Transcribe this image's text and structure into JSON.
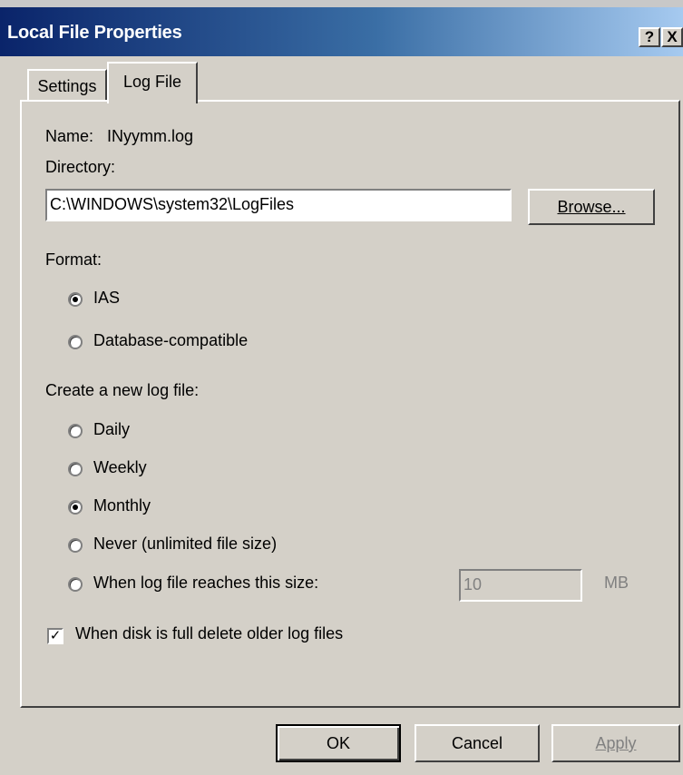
{
  "window": {
    "title": "Local File Properties",
    "help_glyph": "?",
    "close_glyph": "X"
  },
  "tabs": [
    {
      "label": "Settings",
      "selected": false
    },
    {
      "label": "Log File",
      "selected": true
    }
  ],
  "log": {
    "name_label": "Name:",
    "name_value": "INyymm.log",
    "directory_label": "Directory:",
    "directory_value": "C:\\WINDOWS\\system32\\LogFiles",
    "browse_label": "Browse..."
  },
  "format": {
    "label": "Format:",
    "options": [
      {
        "label": "IAS",
        "selected": true
      },
      {
        "label": "Database-compatible",
        "selected": false
      }
    ]
  },
  "new_log": {
    "label": "Create a new log file:",
    "options": [
      {
        "label": "Daily",
        "selected": false
      },
      {
        "label": "Weekly",
        "selected": false
      },
      {
        "label": "Monthly",
        "selected": true
      },
      {
        "label": "Never (unlimited file size)",
        "selected": false
      },
      {
        "label": "When log file reaches this size:",
        "selected": false
      }
    ],
    "size_value": "10",
    "size_unit": "MB"
  },
  "delete_older": {
    "label": "When disk is full delete older log files",
    "checked": true
  },
  "buttons": {
    "ok": "OK",
    "cancel": "Cancel",
    "apply": "Apply"
  }
}
